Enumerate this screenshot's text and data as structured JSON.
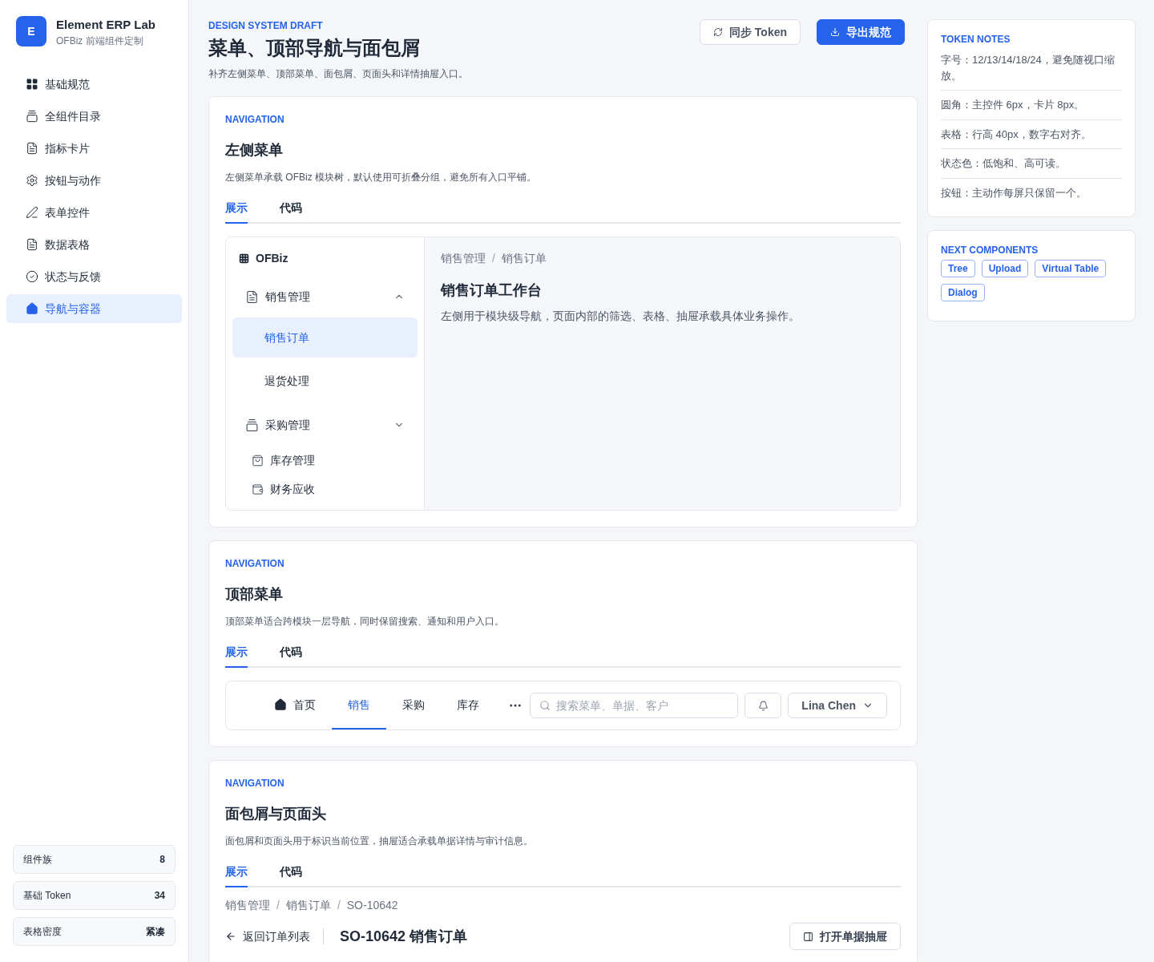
{
  "sidebar": {
    "brand": {
      "logo": "E",
      "title": "Element ERP Lab",
      "subtitle": "OFBiz 前端组件定制"
    },
    "items": [
      {
        "label": "基础规范",
        "selected": false
      },
      {
        "label": "全组件目录",
        "selected": false
      },
      {
        "label": "指标卡片",
        "selected": false
      },
      {
        "label": "按钮与动作",
        "selected": false
      },
      {
        "label": "表单控件",
        "selected": false
      },
      {
        "label": "数据表格",
        "selected": false
      },
      {
        "label": "状态与反馈",
        "selected": false
      },
      {
        "label": "导航与容器",
        "selected": true
      }
    ],
    "stats": [
      {
        "label": "组件族",
        "value": "8"
      },
      {
        "label": "基础 Token",
        "value": "34"
      },
      {
        "label": "表格密度",
        "value": "紧凑"
      }
    ]
  },
  "header": {
    "eyebrow": "DESIGN SYSTEM DRAFT",
    "title": "菜单、顶部导航与面包屑",
    "subtitle": "补齐左侧菜单、顶部菜单、面包屑、页面头和详情抽屉入口。",
    "buttons": [
      {
        "label": "同步 Token",
        "kind": "secondary"
      },
      {
        "label": "导出规范",
        "kind": "primary"
      }
    ]
  },
  "sections": [
    {
      "eyebrow": "NAVIGATION",
      "title": "左侧菜单",
      "description": "左侧菜单承载 OFBiz 模块树，默认使用可折叠分组，避免所有入口平铺。",
      "tabs": [
        {
          "label": "展示",
          "selected": true
        },
        {
          "label": "代码",
          "selected": false
        }
      ],
      "demo": {
        "kind": "side_menu",
        "brand": "OFBiz",
        "tree": [
          {
            "kind": "group",
            "label": "销售管理",
            "expanded": true,
            "children": [
              {
                "label": "销售订单",
                "selected": true
              },
              {
                "label": "退货处理",
                "selected": false
              }
            ]
          },
          {
            "kind": "group",
            "label": "采购管理",
            "expanded": false
          },
          {
            "kind": "item",
            "label": "库存管理"
          },
          {
            "kind": "item",
            "label": "财务应收"
          }
        ],
        "breadcrumb": [
          "销售管理",
          "销售订单"
        ],
        "separator": "/",
        "title": "销售订单工作台",
        "description": "左侧用于模块级导航，页面内部的筛选、表格、抽屉承载具体业务操作。"
      }
    },
    {
      "eyebrow": "NAVIGATION",
      "title": "顶部菜单",
      "description": "顶部菜单适合跨模块一层导航，同时保留搜索、通知和用户入口。",
      "tabs": [
        {
          "label": "展示",
          "selected": true
        },
        {
          "label": "代码",
          "selected": false
        }
      ],
      "demo": {
        "kind": "top_menu",
        "items": [
          {
            "label": "首页",
            "selected": false
          },
          {
            "label": "销售",
            "selected": true
          },
          {
            "label": "采购",
            "selected": false
          },
          {
            "label": "库存",
            "selected": false
          }
        ],
        "search": {
          "placeholder": "搜索菜单、单据、客户"
        },
        "user": "Lina Chen"
      }
    },
    {
      "eyebrow": "NAVIGATION",
      "title": "面包屑与页面头",
      "description": "面包屑和页面头用于标识当前位置，抽屉适合承载单据详情与审计信息。",
      "tabs": [
        {
          "label": "展示",
          "selected": true
        },
        {
          "label": "代码",
          "selected": false
        }
      ],
      "demo": {
        "kind": "page_header",
        "breadcrumb": [
          "销售管理",
          "销售订单",
          "SO-10642"
        ],
        "separator": "/",
        "back": "返回订单列表",
        "title": "SO-10642 销售订单",
        "action": "打开单据抽屉"
      }
    }
  ],
  "aside": {
    "notes": {
      "title": "TOKEN NOTES",
      "items": [
        "字号：12/13/14/18/24，避免随视口缩放。",
        "圆角：主控件 6px，卡片 8px。",
        "表格：行高 40px，数字右对齐。",
        "状态色：低饱和、高可读。",
        "按钮：主动作每屏只保留一个。"
      ]
    },
    "next": {
      "title": "NEXT COMPONENTS",
      "tags": [
        "Tree",
        "Upload",
        "Virtual Table",
        "Dialog"
      ]
    }
  }
}
